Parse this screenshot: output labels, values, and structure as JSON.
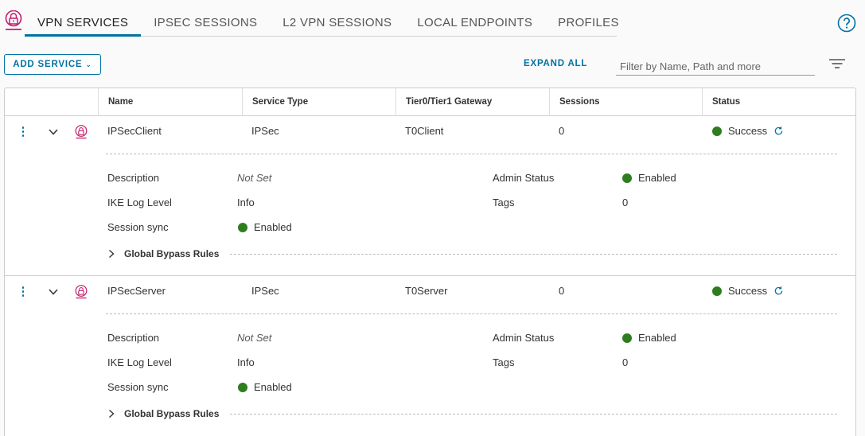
{
  "tabs": [
    {
      "label": "VPN SERVICES",
      "active": true
    },
    {
      "label": "IPSEC SESSIONS",
      "active": false
    },
    {
      "label": "L2 VPN SESSIONS",
      "active": false
    },
    {
      "label": "LOCAL ENDPOINTS",
      "active": false
    },
    {
      "label": "PROFILES",
      "active": false
    }
  ],
  "icons": {
    "brand": "vpn-lock-icon",
    "help": "help-icon",
    "filter": "filter-lines-icon",
    "refresh": "refresh-icon"
  },
  "toolbar": {
    "add_service_label": "ADD SERVICE",
    "expand_all_label": "EXPAND ALL",
    "filter_placeholder": "Filter by Name, Path and more"
  },
  "columns": [
    "Name",
    "Service Type",
    "Tier0/Tier1 Gateway",
    "Sessions",
    "Status"
  ],
  "rows": [
    {
      "name": "IPSecClient",
      "service_type": "IPSec",
      "gateway": "T0Client",
      "sessions": "0",
      "status": "Success",
      "details": {
        "description_label": "Description",
        "description_value": "Not Set",
        "ike_label": "IKE Log Level",
        "ike_value": "Info",
        "sync_label": "Session sync",
        "sync_value": "Enabled",
        "admin_label": "Admin Status",
        "admin_value": "Enabled",
        "tags_label": "Tags",
        "tags_value": "0",
        "bypass_label": "Global Bypass Rules"
      }
    },
    {
      "name": "IPSecServer",
      "service_type": "IPSec",
      "gateway": "T0Server",
      "sessions": "0",
      "status": "Success",
      "details": {
        "description_label": "Description",
        "description_value": "Not Set",
        "ike_label": "IKE Log Level",
        "ike_value": "Info",
        "sync_label": "Session sync",
        "sync_value": "Enabled",
        "admin_label": "Admin Status",
        "admin_value": "Enabled",
        "tags_label": "Tags",
        "tags_value": "0",
        "bypass_label": "Global Bypass Rules"
      }
    }
  ],
  "colors": {
    "accent": "#0072a3",
    "success": "#2e7d1f",
    "icon_pink": "#c21d6b"
  }
}
